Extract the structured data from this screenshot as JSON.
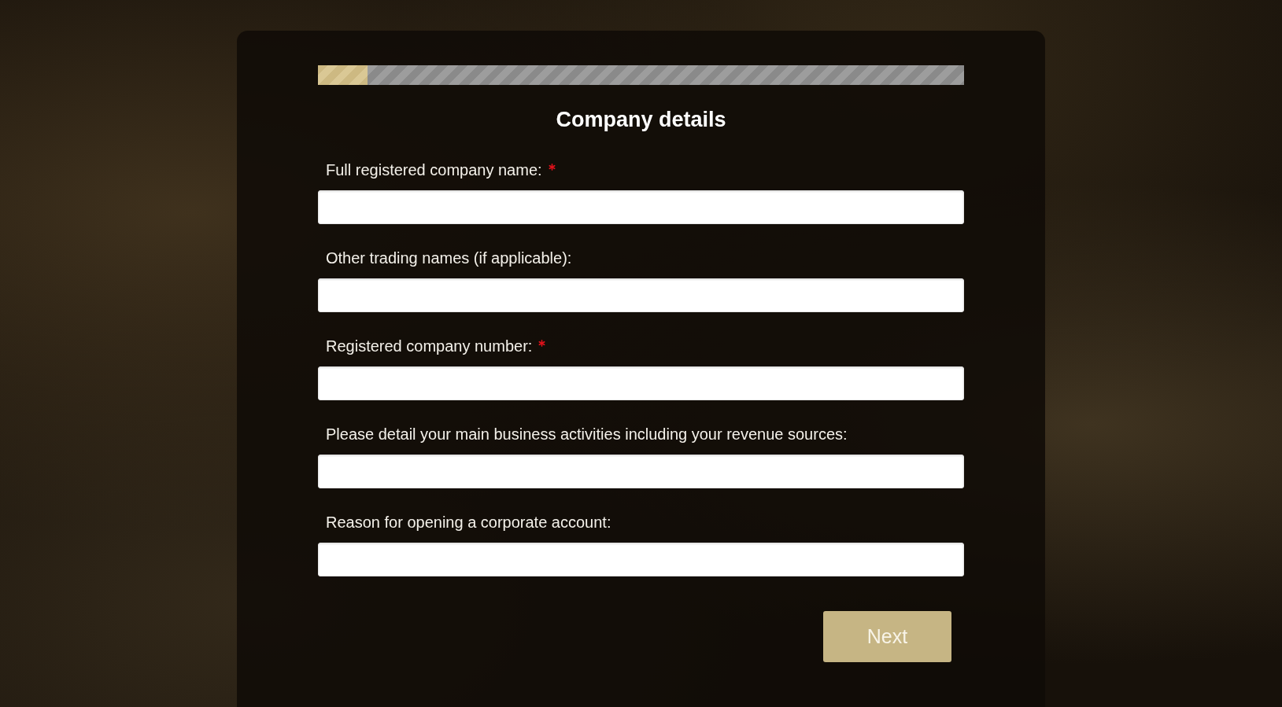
{
  "progress": {
    "level": 0.077
  },
  "heading": "Company details",
  "fields": [
    {
      "label": "Full registered company name:",
      "required": true
    },
    {
      "label": "Other trading names (if applicable):",
      "required": false
    },
    {
      "label": "Registered company number:",
      "required": true
    },
    {
      "label": "Please detail your main business activities including your revenue sources:",
      "required": false
    },
    {
      "label": "Reason for opening a corporate account:",
      "required": false
    }
  ],
  "next_button": {
    "label": "Next"
  }
}
